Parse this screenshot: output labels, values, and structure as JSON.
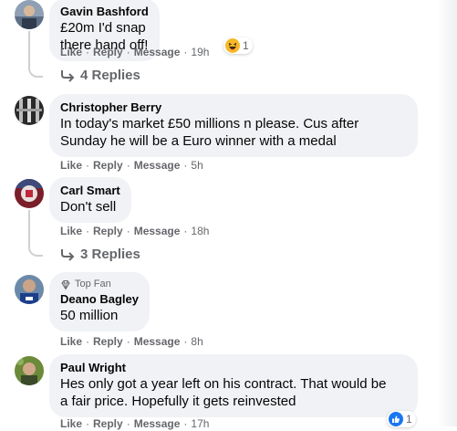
{
  "actions": {
    "like": "Like",
    "reply": "Reply",
    "message": "Message",
    "separator": "·"
  },
  "comments": [
    {
      "name": "Gavin Bashford",
      "text": "£20m I'd snap there hand off!",
      "time": "19h",
      "reaction": {
        "type": "haha",
        "count": "1"
      },
      "replies": "4 Replies"
    },
    {
      "name": "Christopher Berry",
      "text": "In today's market £50 millions n please. Cus after\nSunday he will be a Euro winner with a medal",
      "time": "5h"
    },
    {
      "name": "Carl Smart",
      "text": "Don't sell",
      "time": "18h",
      "replies": "3 Replies"
    },
    {
      "name": "Deano Bagley",
      "badge": "Top Fan",
      "text": "50 million",
      "time": "8h"
    },
    {
      "name": "Paul Wright",
      "text": "Hes only got a year left on his contract. That would be\na fair price. Hopefully it gets reinvested",
      "time": "17h",
      "reaction": {
        "type": "like",
        "count": "1"
      }
    }
  ],
  "colors": {
    "bubble": "#f0f2f5",
    "secondary_text": "#65676b",
    "primary_text": "#050505",
    "thread_line": "#ced0d4",
    "like_blue": "#1877f2",
    "haha_yellow": "#f7b928"
  }
}
